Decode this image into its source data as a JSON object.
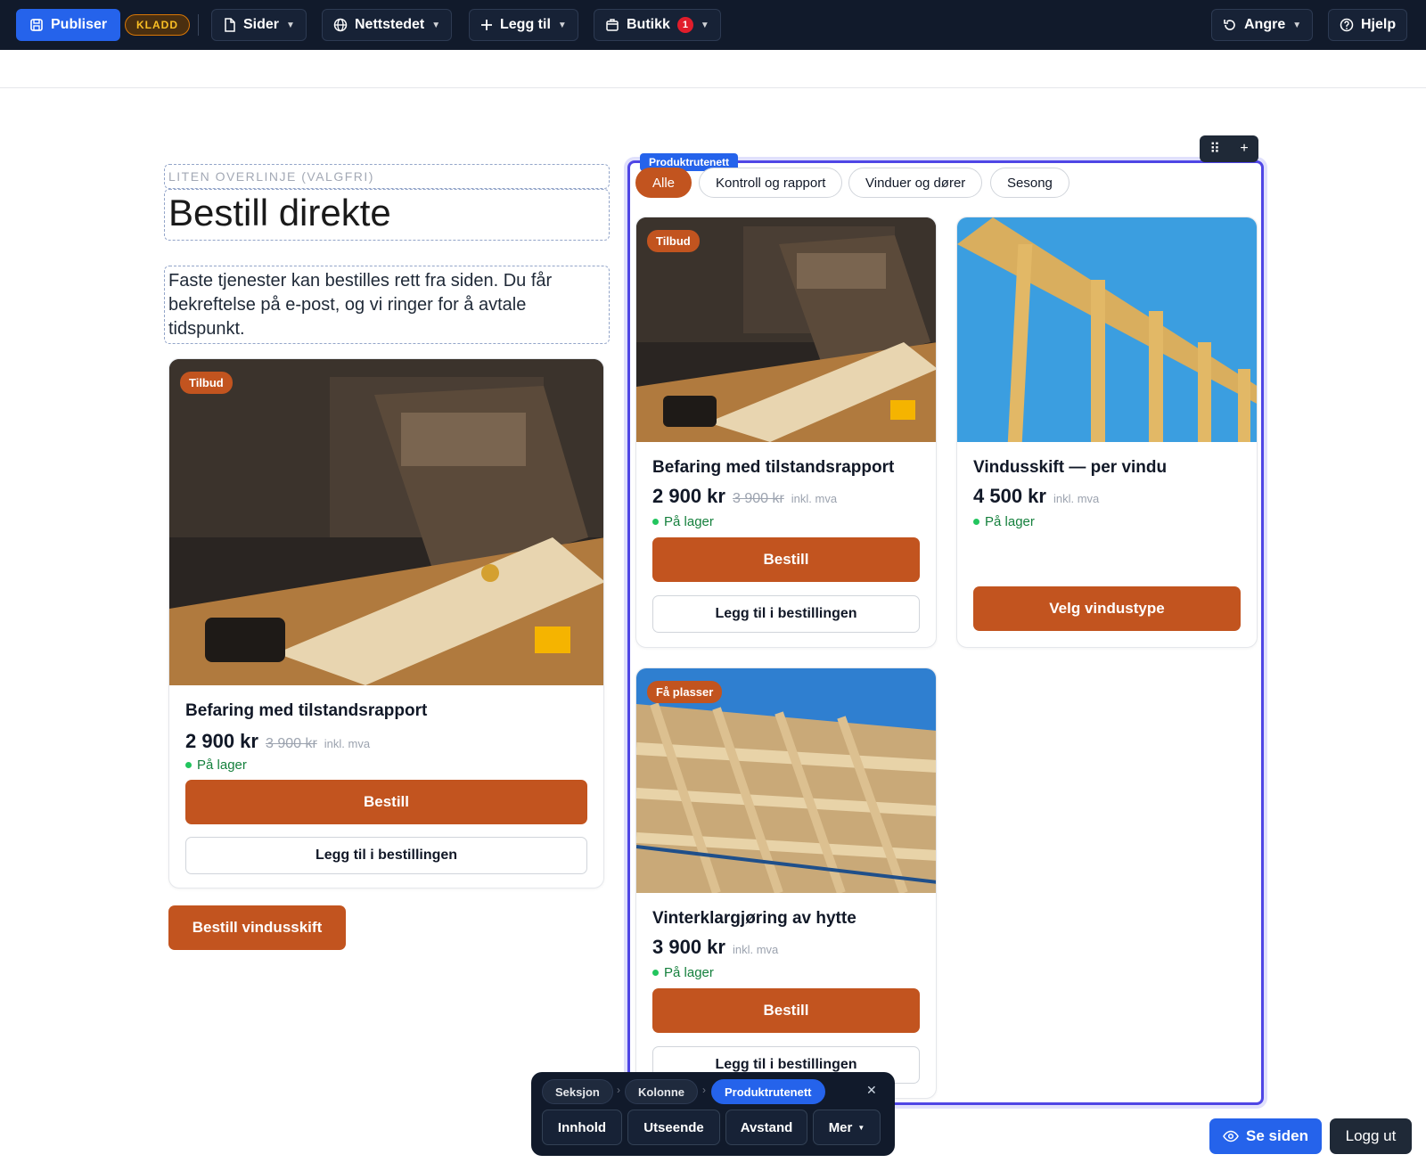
{
  "topbar": {
    "publish_label": "Publiser",
    "status_badge": "KLADD",
    "pages_label": "Sider",
    "website_label": "Nettstedet",
    "add_label": "Legg til",
    "shop_label": "Butikk",
    "shop_count": "1",
    "undo_label": "Angre",
    "help_label": "Hjelp"
  },
  "section": {
    "overline": "LITEN OVERLINJE (VALGFRI)",
    "title": "Bestill direkte",
    "intro": "Faste tjenester kan bestilles rett fra siden. Du får bekreftelse på e-post, og vi ringer for å avtale tidspunkt.",
    "cta_label": "Bestill vindusskift"
  },
  "featured_card": {
    "tag": "Tilbud",
    "title": "Befaring med tilstandsrapport",
    "price": "2 900 kr",
    "old_price": "3 900 kr",
    "vat": "inkl. mva",
    "stock": "På lager",
    "order_label": "Bestill",
    "add_label": "Legg til i bestillingen"
  },
  "product_grid": {
    "label": "Produktrutenett",
    "filters": [
      "Alle",
      "Kontroll og rapport",
      "Vinduer og dører",
      "Sesong"
    ],
    "active_filter": "Alle",
    "products": [
      {
        "tag": "Tilbud",
        "title": "Befaring med tilstandsrapport",
        "price": "2 900 kr",
        "old_price": "3 900 kr",
        "vat": "inkl. mva",
        "stock": "På lager",
        "primary_label": "Bestill",
        "secondary_label": "Legg til i bestillingen"
      },
      {
        "tag": "",
        "title": "Vindusskift — per vindu",
        "price": "4 500 kr",
        "old_price": "",
        "vat": "inkl. mva",
        "stock": "På lager",
        "primary_label": "Velg vindustype",
        "secondary_label": ""
      },
      {
        "tag": "Få plasser",
        "title": "Vinterklargjøring av hytte",
        "price": "3 900 kr",
        "old_price": "",
        "vat": "inkl. mva",
        "stock": "På lager",
        "primary_label": "Bestill",
        "secondary_label": "Legg til i bestillingen"
      }
    ]
  },
  "floating_toolbar": {
    "breadcrumbs": [
      "Seksjon",
      "Kolonne",
      "Produktrutenett"
    ],
    "buttons": [
      "Innhold",
      "Utseende",
      "Avstand",
      "Mer"
    ]
  },
  "footer_actions": {
    "view_label": "Se siden",
    "logout_label": "Logg ut"
  },
  "colors": {
    "topbar": "#111a2b",
    "primary": "#2563eb",
    "accent": "#c2541f",
    "stock": "#15803d",
    "selection": "#4f46e5"
  }
}
